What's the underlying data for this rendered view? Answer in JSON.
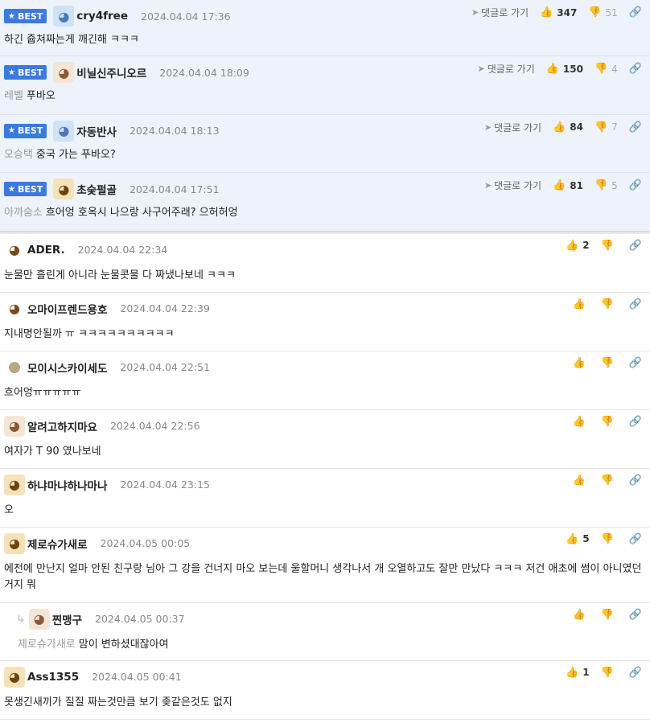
{
  "best_label": "BEST",
  "goto_label": "댓글로 가기",
  "best_comments": [
    {
      "nick": "cry4free",
      "time": "2024.04.04 17:36",
      "mention": "",
      "text": "하긴 쥽쳐짜는게 깨긴해 ㅋㅋㅋ",
      "up": "347",
      "down": "51",
      "avatar": "blue"
    },
    {
      "nick": "비닐신주니오르",
      "time": "2024.04.04 18:09",
      "mention": "레벨",
      "text": "푸바오",
      "up": "150",
      "down": "4",
      "avatar": "puppy"
    },
    {
      "nick": "자동반사",
      "time": "2024.04.04 18:13",
      "mention": "오승택",
      "text": "중국 가는 푸바오?",
      "up": "84",
      "down": "7",
      "avatar": "blue"
    },
    {
      "nick": "초숮펄골",
      "time": "2024.04.04 17:51",
      "mention": "아까숨소",
      "text": "흐어엉 호옥시 나으랑 사구어주래? 으허허엉",
      "up": "81",
      "down": "5",
      "avatar": "dog"
    }
  ],
  "comments": [
    {
      "nick": "ADER.",
      "time": "2024.04.04 22:34",
      "mention": "",
      "text": "눈물만 흘린게 아니라 눈물콧물 다 짜냈나보네 ㅋㅋㅋ",
      "up": "2",
      "down": "",
      "avatar": "fox",
      "reply": false
    },
    {
      "nick": "오마이프렌드용호",
      "time": "2024.04.04 22:39",
      "mention": "",
      "text": "지내명안될까 ㅠ ㅋㅋㅋㅋㅋㅋㅋㅋㅋㅋ",
      "up": "",
      "down": "",
      "avatar": "fox",
      "reply": false
    },
    {
      "nick": "모이시스카이세도",
      "time": "2024.04.04 22:51",
      "mention": "",
      "text": "흐어엉ㅠㅠㅠㅠㅠ",
      "up": "",
      "down": "",
      "avatar": "round",
      "reply": false
    },
    {
      "nick": "알려고하지마요",
      "time": "2024.04.04 22:56",
      "mention": "",
      "text": "여자가 T 90 였나보네",
      "up": "",
      "down": "",
      "avatar": "puppy",
      "reply": false
    },
    {
      "nick": "하냐마냐하나마나",
      "time": "2024.04.04 23:15",
      "mention": "",
      "text": "오",
      "up": "",
      "down": "",
      "avatar": "dog",
      "reply": false
    },
    {
      "nick": "제로슈가새로",
      "time": "2024.04.05 00:05",
      "mention": "",
      "text": "에전에 만난지 얼마 안된 친구랑 님아 그 강을 건너지 마오 보는데 울할머니 생각나서 개 오열하고도 잘만 만났다 ㅋㅋㅋ 저건 애초에 썸이 아니였던거지 뭐",
      "up": "5",
      "down": "",
      "avatar": "dog",
      "reply": false
    },
    {
      "nick": "찐맹구",
      "time": "2024.04.05 00:37",
      "mention": "제로슈가새로",
      "text": "맘이 변하셨대잖아여",
      "up": "",
      "down": "",
      "avatar": "puppy",
      "reply": true
    },
    {
      "nick": "Ass1355",
      "time": "2024.04.05 00:41",
      "mention": "",
      "text": "못생긴새끼가 질질 짜는것만큼 보기 좆같은것도 없지",
      "up": "1",
      "down": "",
      "avatar": "dog",
      "reply": false
    }
  ]
}
